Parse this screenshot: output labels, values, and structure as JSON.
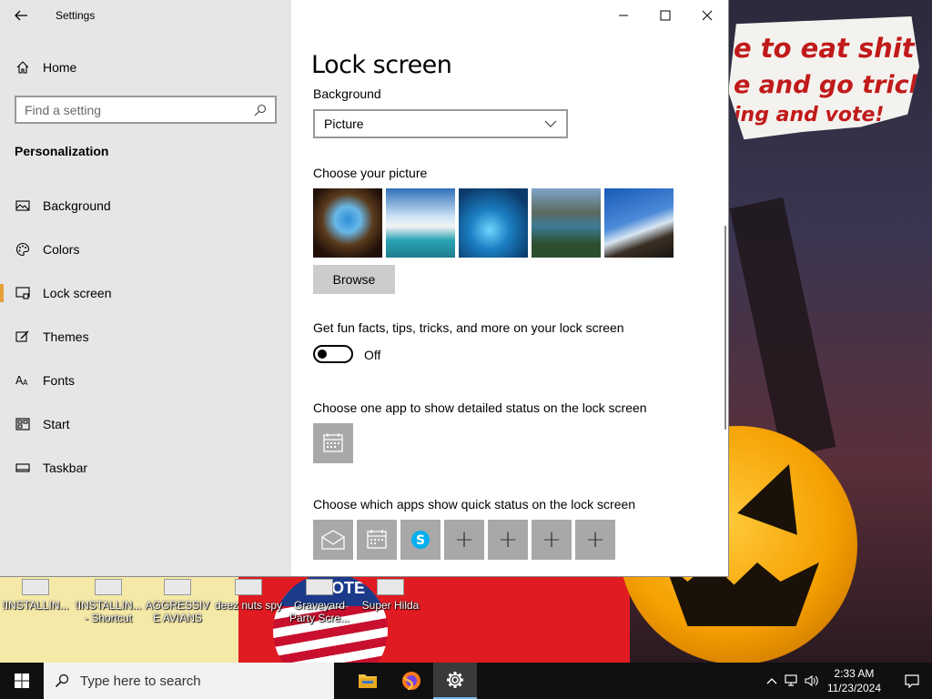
{
  "window": {
    "title": "Settings"
  },
  "sidebar": {
    "home": "Home",
    "search_placeholder": "Find a setting",
    "section": "Personalization",
    "items": [
      {
        "label": "Background",
        "icon": "picture-icon"
      },
      {
        "label": "Colors",
        "icon": "palette-icon"
      },
      {
        "label": "Lock screen",
        "icon": "lock-screen-icon",
        "active": true
      },
      {
        "label": "Themes",
        "icon": "themes-icon"
      },
      {
        "label": "Fonts",
        "icon": "fonts-icon"
      },
      {
        "label": "Start",
        "icon": "start-icon"
      },
      {
        "label": "Taskbar",
        "icon": "taskbar-icon"
      }
    ]
  },
  "main": {
    "title": "Lock screen",
    "background_label": "Background",
    "background_value": "Picture",
    "choose_picture_label": "Choose your picture",
    "browse_label": "Browse",
    "fun_facts_label": "Get fun facts, tips, tricks, and more on your lock screen",
    "fun_facts_state": "Off",
    "detailed_status_label": "Choose one app to show detailed status on the lock screen",
    "quick_status_label": "Choose which apps show quick status on the lock screen"
  },
  "desktop": {
    "wallpaper_text": [
      "e to eat shit",
      "e and go trick",
      "ing and vote!"
    ],
    "icons": [
      "!INSTALLIN...",
      "!INSTALLIN... - Shortcut",
      "AGGRESSIVE AVIANS",
      "deez nuts spy",
      "Graveyard Party Scre...",
      "Super Hilda"
    ],
    "wallpaper_sign": "VOTE"
  },
  "taskbar": {
    "search_placeholder": "Type here to search",
    "time": "2:33 AM",
    "date": "11/23/2024"
  },
  "colors": {
    "accent": "#e8a03a",
    "taskbar": "#101010",
    "sidebar": "#e6e6e6"
  }
}
